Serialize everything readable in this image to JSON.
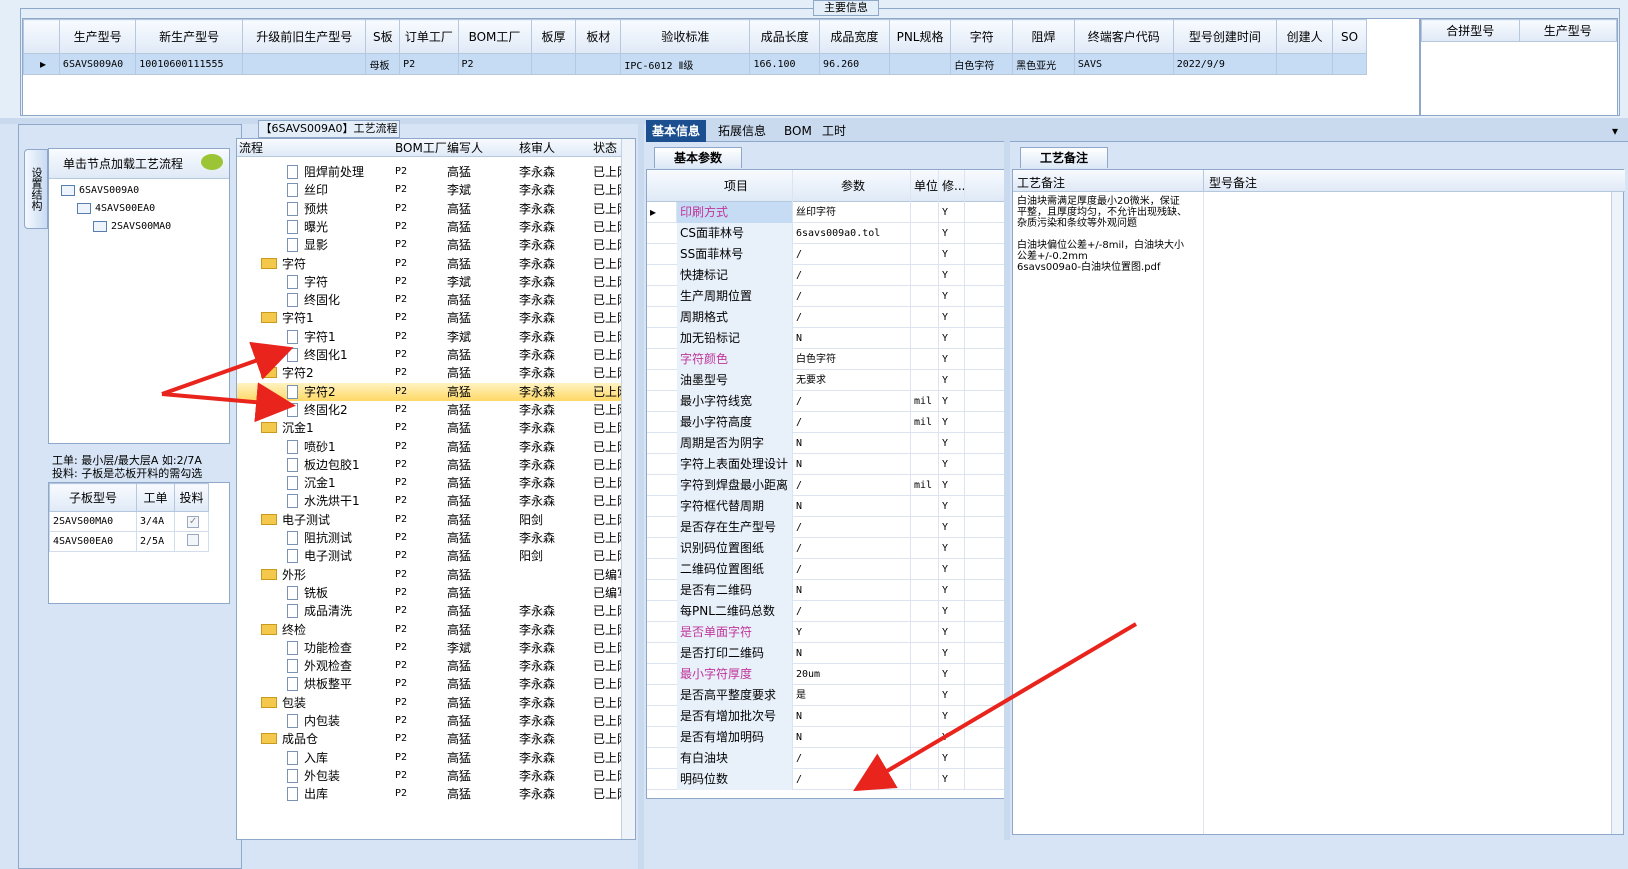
{
  "main_info": {
    "title": "主要信息",
    "columns": [
      "生产型号",
      "新生产型号",
      "升级前旧生产型号",
      "S板",
      "订单工厂",
      "BOM工厂",
      "板厚",
      "板材",
      "验收标准",
      "成品长度",
      "成品宽度",
      "PNL规格",
      "字符",
      "阻焊",
      "终端客户代码",
      "型号创建时间",
      "创建人",
      "SO"
    ],
    "row": [
      "6SAVS009A0",
      "10010600111555",
      "",
      "母板",
      "P2",
      "P2",
      "",
      "",
      "IPC-6012 Ⅱ级",
      "166.100",
      "96.260",
      "",
      "白色字符",
      "黑色亚光",
      "SAVS",
      "2022/9/9",
      "",
      ""
    ]
  },
  "merge_grid": {
    "columns": [
      "合拼型号",
      "生产型号"
    ]
  },
  "left_panel": {
    "vertical_tab": "设置结构",
    "tree_header": "单击节点加载工艺流程",
    "tree": [
      "6SAVS009A0",
      "4SAVS00EA0",
      "2SAVS00MA0"
    ],
    "info_line1": "工单: 最小层/最大层A 如:2/7A",
    "info_line2": "投料: 子板是芯板开料的需勾选",
    "subgrid": {
      "columns": [
        "子板型号",
        "工单",
        "投料"
      ],
      "rows": [
        {
          "model": "2SAVS00MA0",
          "order": "3/4A",
          "checked": true
        },
        {
          "model": "4SAVS00EA0",
          "order": "2/5A",
          "checked": false
        }
      ]
    }
  },
  "process": {
    "title": "【6SAVS009A0】工艺流程",
    "columns": [
      "流程",
      "BOM工厂",
      "编写人",
      "核审人",
      "状态"
    ],
    "rows": [
      {
        "kind": "item",
        "name": "阻焊前处理",
        "factory": "P2",
        "writer": "高猛",
        "reviewer": "李永森",
        "status": "已上网"
      },
      {
        "kind": "item",
        "name": "丝印",
        "factory": "P2",
        "writer": "李斌",
        "reviewer": "李永森",
        "status": "已上网"
      },
      {
        "kind": "item",
        "name": "预烘",
        "factory": "P2",
        "writer": "高猛",
        "reviewer": "李永森",
        "status": "已上网"
      },
      {
        "kind": "item",
        "name": "曝光",
        "factory": "P2",
        "writer": "高猛",
        "reviewer": "李永森",
        "status": "已上网"
      },
      {
        "kind": "item",
        "name": "显影",
        "factory": "P2",
        "writer": "高猛",
        "reviewer": "李永森",
        "status": "已上网"
      },
      {
        "kind": "folder",
        "name": "字符",
        "factory": "P2",
        "writer": "高猛",
        "reviewer": "李永森",
        "status": "已上网"
      },
      {
        "kind": "item",
        "name": "字符",
        "factory": "P2",
        "writer": "李斌",
        "reviewer": "李永森",
        "status": "已上网"
      },
      {
        "kind": "item",
        "name": "终固化",
        "factory": "P2",
        "writer": "高猛",
        "reviewer": "李永森",
        "status": "已上网"
      },
      {
        "kind": "folder",
        "name": "字符1",
        "factory": "P2",
        "writer": "高猛",
        "reviewer": "李永森",
        "status": "已上网"
      },
      {
        "kind": "item",
        "name": "字符1",
        "factory": "P2",
        "writer": "李斌",
        "reviewer": "李永森",
        "status": "已上网"
      },
      {
        "kind": "item",
        "name": "终固化1",
        "factory": "P2",
        "writer": "高猛",
        "reviewer": "李永森",
        "status": "已上网"
      },
      {
        "kind": "folder",
        "name": "字符2",
        "factory": "P2",
        "writer": "高猛",
        "reviewer": "李永森",
        "status": "已上网"
      },
      {
        "kind": "item",
        "name": "字符2",
        "factory": "P2",
        "writer": "高猛",
        "reviewer": "李永森",
        "status": "已上网",
        "selected": true
      },
      {
        "kind": "item",
        "name": "终固化2",
        "factory": "P2",
        "writer": "高猛",
        "reviewer": "李永森",
        "status": "已上网"
      },
      {
        "kind": "folder",
        "name": "沉金1",
        "factory": "P2",
        "writer": "高猛",
        "reviewer": "李永森",
        "status": "已上网"
      },
      {
        "kind": "item",
        "name": "喷砂1",
        "factory": "P2",
        "writer": "高猛",
        "reviewer": "李永森",
        "status": "已上网"
      },
      {
        "kind": "item",
        "name": "板边包胶1",
        "factory": "P2",
        "writer": "高猛",
        "reviewer": "李永森",
        "status": "已上网"
      },
      {
        "kind": "item",
        "name": "沉金1",
        "factory": "P2",
        "writer": "高猛",
        "reviewer": "李永森",
        "status": "已上网"
      },
      {
        "kind": "item",
        "name": "水洗烘干1",
        "factory": "P2",
        "writer": "高猛",
        "reviewer": "李永森",
        "status": "已上网"
      },
      {
        "kind": "folder",
        "name": "电子测试",
        "factory": "P2",
        "writer": "高猛",
        "reviewer": "阳剑",
        "status": "已上网"
      },
      {
        "kind": "item",
        "name": "阻抗测试",
        "factory": "P2",
        "writer": "高猛",
        "reviewer": "李永森",
        "status": "已上网"
      },
      {
        "kind": "item",
        "name": "电子测试",
        "factory": "P2",
        "writer": "高猛",
        "reviewer": "阳剑",
        "status": "已上网"
      },
      {
        "kind": "folder",
        "name": "外形",
        "factory": "P2",
        "writer": "高猛",
        "reviewer": "",
        "status": "已编写"
      },
      {
        "kind": "item",
        "name": "铣板",
        "factory": "P2",
        "writer": "高猛",
        "reviewer": "",
        "status": "已编写"
      },
      {
        "kind": "item",
        "name": "成品清洗",
        "factory": "P2",
        "writer": "高猛",
        "reviewer": "李永森",
        "status": "已上网"
      },
      {
        "kind": "folder",
        "name": "终检",
        "factory": "P2",
        "writer": "高猛",
        "reviewer": "李永森",
        "status": "已上网"
      },
      {
        "kind": "item",
        "name": "功能检查",
        "factory": "P2",
        "writer": "李斌",
        "reviewer": "李永森",
        "status": "已上网"
      },
      {
        "kind": "item",
        "name": "外观检查",
        "factory": "P2",
        "writer": "高猛",
        "reviewer": "李永森",
        "status": "已上网"
      },
      {
        "kind": "item",
        "name": "烘板整平",
        "factory": "P2",
        "writer": "高猛",
        "reviewer": "李永森",
        "status": "已上网"
      },
      {
        "kind": "folder",
        "name": "包装",
        "factory": "P2",
        "writer": "高猛",
        "reviewer": "李永森",
        "status": "已上网"
      },
      {
        "kind": "item",
        "name": "内包装",
        "factory": "P2",
        "writer": "高猛",
        "reviewer": "李永森",
        "status": "已上网"
      },
      {
        "kind": "folder",
        "name": "成品仓",
        "factory": "P2",
        "writer": "高猛",
        "reviewer": "李永森",
        "status": "已上网"
      },
      {
        "kind": "item",
        "name": "入库",
        "factory": "P2",
        "writer": "高猛",
        "reviewer": "李永森",
        "status": "已上网"
      },
      {
        "kind": "item",
        "name": "外包装",
        "factory": "P2",
        "writer": "高猛",
        "reviewer": "李永森",
        "status": "已上网"
      },
      {
        "kind": "item",
        "name": "出库",
        "factory": "P2",
        "writer": "高猛",
        "reviewer": "李永森",
        "status": "已上网"
      }
    ]
  },
  "right_tabs": [
    "基本信息",
    "拓展信息",
    "BOM",
    "工时"
  ],
  "basic": {
    "tab_label": "基本参数",
    "columns": [
      "项目",
      "参数",
      "单位",
      "修..."
    ],
    "rows": [
      {
        "item": "印刷方式",
        "value": "丝印字符",
        "unit": "",
        "mod": "Y",
        "pink": true
      },
      {
        "item": "CS面菲林号",
        "value": "6savs009a0.tol",
        "unit": "",
        "mod": "Y"
      },
      {
        "item": "SS面菲林号",
        "value": "/",
        "unit": "",
        "mod": "Y"
      },
      {
        "item": "快捷标记",
        "value": "/",
        "unit": "",
        "mod": "Y"
      },
      {
        "item": "生产周期位置",
        "value": "/",
        "unit": "",
        "mod": "Y"
      },
      {
        "item": "周期格式",
        "value": "/",
        "unit": "",
        "mod": "Y"
      },
      {
        "item": "加无铅标记",
        "value": "N",
        "unit": "",
        "mod": "Y"
      },
      {
        "item": "字符颜色",
        "value": "白色字符",
        "unit": "",
        "mod": "Y",
        "pink": true
      },
      {
        "item": "油墨型号",
        "value": "无要求",
        "unit": "",
        "mod": "Y"
      },
      {
        "item": "最小字符线宽",
        "value": "/",
        "unit": "mil",
        "mod": "Y"
      },
      {
        "item": "最小字符高度",
        "value": "/",
        "unit": "mil",
        "mod": "Y"
      },
      {
        "item": "周期是否为阴字",
        "value": "N",
        "unit": "",
        "mod": "Y"
      },
      {
        "item": "字符上表面处理设计",
        "value": "N",
        "unit": "",
        "mod": "Y"
      },
      {
        "item": "字符到焊盘最小距离",
        "value": "/",
        "unit": "mil",
        "mod": "Y"
      },
      {
        "item": "字符框代替周期",
        "value": "N",
        "unit": "",
        "mod": "Y"
      },
      {
        "item": "是否存在生产型号",
        "value": "/",
        "unit": "",
        "mod": "Y"
      },
      {
        "item": "识别码位置图纸",
        "value": "/",
        "unit": "",
        "mod": "Y"
      },
      {
        "item": "二维码位置图纸",
        "value": "/",
        "unit": "",
        "mod": "Y"
      },
      {
        "item": "是否有二维码",
        "value": "N",
        "unit": "",
        "mod": "Y"
      },
      {
        "item": "每PNL二维码总数",
        "value": "/",
        "unit": "",
        "mod": "Y"
      },
      {
        "item": "是否单面字符",
        "value": "Y",
        "unit": "",
        "mod": "Y",
        "pink": true
      },
      {
        "item": "是否打印二维码",
        "value": "N",
        "unit": "",
        "mod": "Y"
      },
      {
        "item": "最小字符厚度",
        "value": "20um",
        "unit": "",
        "mod": "Y",
        "pink": true
      },
      {
        "item": "是否高平整度要求",
        "value": "是",
        "unit": "",
        "mod": "Y"
      },
      {
        "item": "是否有增加批次号",
        "value": "N",
        "unit": "",
        "mod": "Y"
      },
      {
        "item": "是否有增加明码",
        "value": "N",
        "unit": "",
        "mod": "Y"
      },
      {
        "item": "有白油块",
        "value": "/",
        "unit": "",
        "mod": "Y"
      },
      {
        "item": "明码位数",
        "value": "/",
        "unit": "",
        "mod": "Y"
      }
    ]
  },
  "remark": {
    "tab_label": "工艺备注",
    "columns": [
      "工艺备注",
      "型号备注"
    ],
    "text": "白油块需满足厚度最小20微米，保证平整，且厚度均匀，不允许出现残缺、杂质污染和条纹等外观问题\n\n白油块偏位公差+/-8mil，白油块大小公差+/-0.2mm\n6savs009a0-白油块位置图.pdf"
  },
  "colors": {
    "accent": "#1c4f8f",
    "selected_row": "#c6dcf5",
    "highlight": "#ffd966",
    "annotation_arrow": "#e8241c",
    "pink_text": "#c0359a"
  }
}
